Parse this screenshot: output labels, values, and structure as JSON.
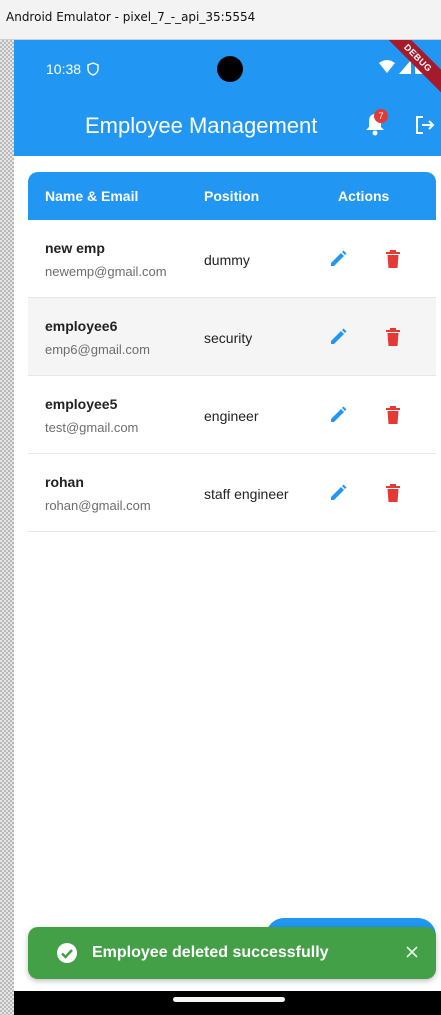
{
  "window": {
    "title": "Android Emulator - pixel_7_-_api_35:5554"
  },
  "status_bar": {
    "time": "10:38",
    "debug_label": "DEBUG"
  },
  "app_bar": {
    "title": "Employee Management",
    "notification_count": "7",
    "icons": [
      "bell-icon",
      "logout-icon"
    ]
  },
  "table": {
    "headers": {
      "name_email": "Name & Email",
      "position": "Position",
      "actions": "Actions"
    },
    "rows": [
      {
        "name": "new emp",
        "email": "newemp@gmail.com",
        "position": "dummy"
      },
      {
        "name": "employee6",
        "email": "emp6@gmail.com",
        "position": "security"
      },
      {
        "name": "employee5",
        "email": "test@gmail.com",
        "position": "engineer"
      },
      {
        "name": "rohan",
        "email": "rohan@gmail.com",
        "position": "staff engineer"
      }
    ]
  },
  "snackbar": {
    "message": "Employee deleted successfully"
  },
  "colors": {
    "primary": "#2196f3",
    "delete": "#e53935",
    "success": "#43a047"
  }
}
